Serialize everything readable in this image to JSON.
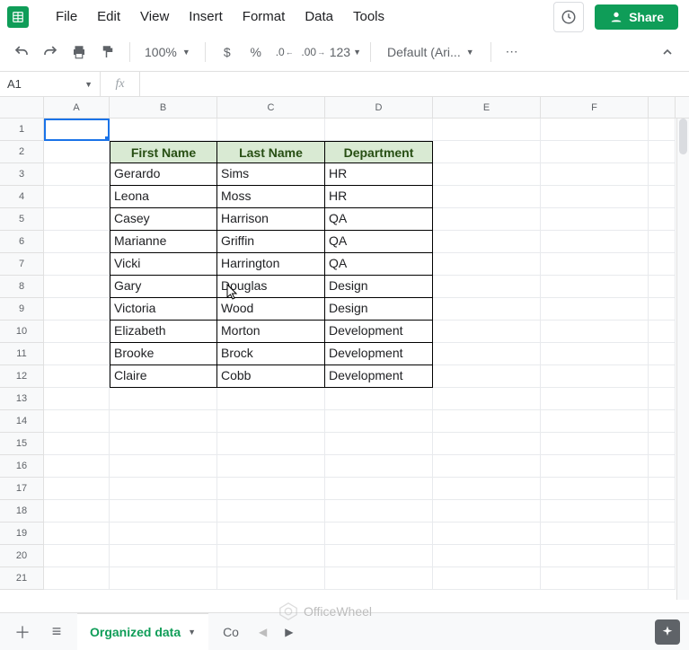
{
  "menu": {
    "file": "File",
    "edit": "Edit",
    "view": "View",
    "insert": "Insert",
    "format": "Format",
    "data": "Data",
    "tools": "Tools"
  },
  "share": {
    "label": "Share"
  },
  "toolbar": {
    "zoom": "100%",
    "currency": "$",
    "percent": "%",
    "dec_dec": ".0",
    "dec_inc": ".00",
    "numfmt": "123",
    "font": "Default (Ari...",
    "more": "⋯"
  },
  "namebox": {
    "value": "A1"
  },
  "fx": {
    "label": "fx",
    "value": ""
  },
  "columns": [
    "A",
    "B",
    "C",
    "D",
    "E",
    "F",
    ""
  ],
  "rowcount": 21,
  "table": {
    "headers": {
      "b": "First Name",
      "c": "Last Name",
      "d": "Department"
    },
    "rows": [
      {
        "b": "Gerardo",
        "c": "Sims",
        "d": "HR"
      },
      {
        "b": "Leona",
        "c": "Moss",
        "d": "HR"
      },
      {
        "b": "Casey",
        "c": "Harrison",
        "d": "QA"
      },
      {
        "b": "Marianne",
        "c": "Griffin",
        "d": "QA"
      },
      {
        "b": "Vicki",
        "c": "Harrington",
        "d": "QA"
      },
      {
        "b": "Gary",
        "c": "Douglas",
        "d": "Design"
      },
      {
        "b": "Victoria",
        "c": "Wood",
        "d": "Design"
      },
      {
        "b": "Elizabeth",
        "c": "Morton",
        "d": "Development"
      },
      {
        "b": "Brooke",
        "c": "Brock",
        "d": "Development"
      },
      {
        "b": "Claire",
        "c": "Cobb",
        "d": "Development"
      }
    ]
  },
  "sheet_tab": {
    "active": "Organized data",
    "other": "Co"
  },
  "watermark": "OfficeWheel"
}
